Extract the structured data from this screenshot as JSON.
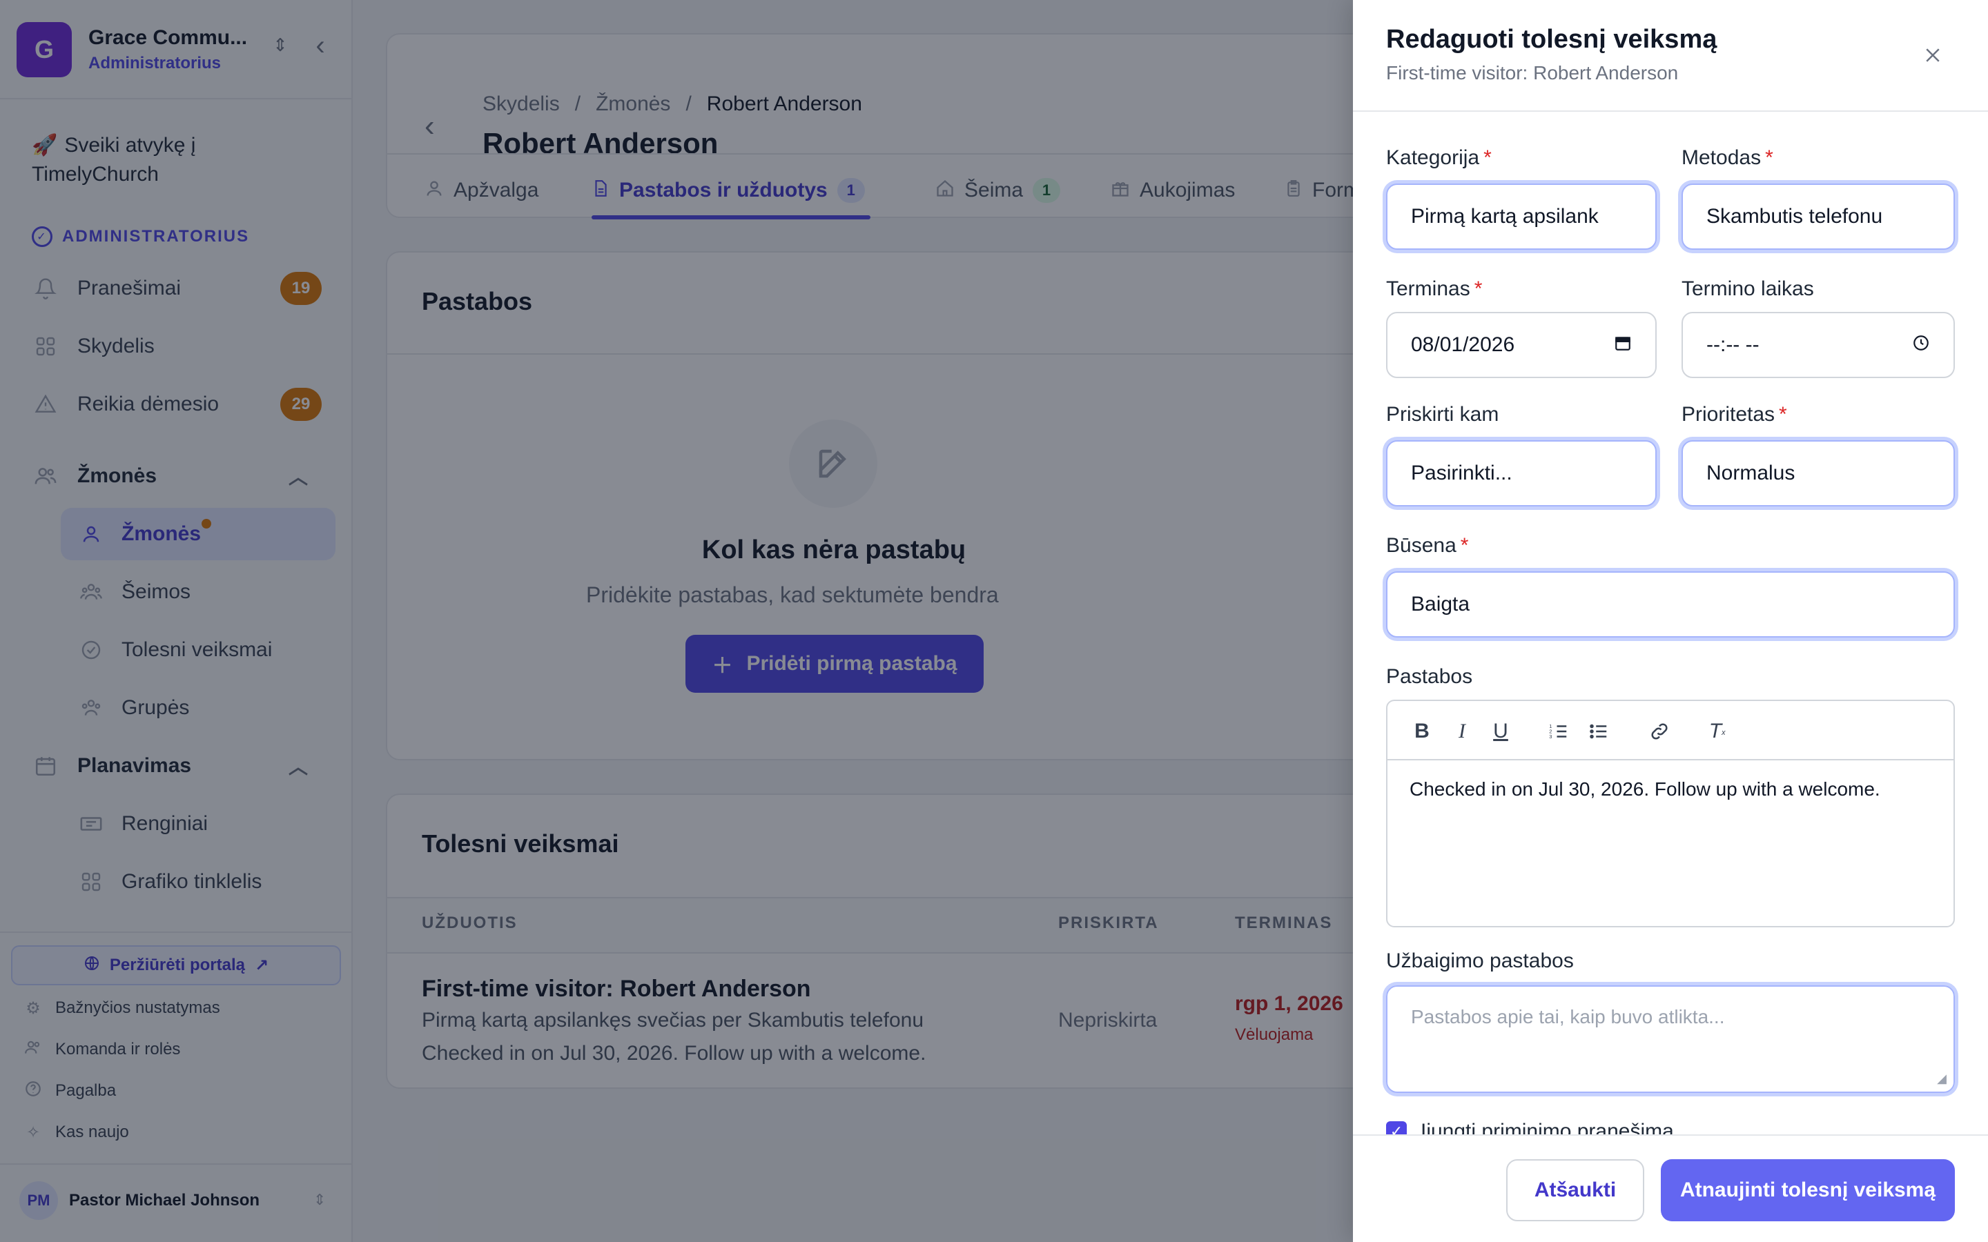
{
  "sidebar": {
    "org": {
      "initial": "G",
      "name": "Grace Commu...",
      "role": "Administratorius"
    },
    "welcome": "Sveiki atvykę į TimelyChurch",
    "section_label": "ADMINISTRATORIUS",
    "items": [
      {
        "label": "Pranešimai",
        "icon": "bell-icon",
        "badge": "19"
      },
      {
        "label": "Skydelis",
        "icon": "grid-icon"
      },
      {
        "label": "Reikia dėmesio",
        "icon": "warning-icon",
        "badge": "29"
      }
    ],
    "group_people": {
      "label": "Žmonės",
      "icon": "users-icon"
    },
    "people_items": [
      {
        "label": "Žmonės",
        "icon": "user-icon",
        "active": true
      },
      {
        "label": "Šeimos",
        "icon": "family-icon"
      },
      {
        "label": "Tolesni veiksmai",
        "icon": "check-circle-icon"
      },
      {
        "label": "Grupės",
        "icon": "group-icon"
      }
    ],
    "group_planning": {
      "label": "Planavimas",
      "icon": "calendar-icon"
    },
    "planning_items": [
      {
        "label": "Renginiai",
        "icon": "ticket-icon"
      },
      {
        "label": "Grafiko tinklelis",
        "icon": "grid-icon"
      }
    ],
    "portal_button": "Peržiūrėti portalą",
    "footer_links": [
      {
        "label": "Bažnyčios nustatymas",
        "icon": "gear-icon"
      },
      {
        "label": "Komanda ir rolės",
        "icon": "users-icon"
      },
      {
        "label": "Pagalba",
        "icon": "help-icon"
      },
      {
        "label": "Kas naujo",
        "icon": "sparkle-icon"
      }
    ],
    "user": {
      "initials": "PM",
      "name": "Pastor Michael Johnson"
    }
  },
  "main": {
    "breadcrumbs": [
      "Skydelis",
      "Žmonės",
      "Robert Anderson"
    ],
    "title": "Robert Anderson",
    "tabs": [
      {
        "label": "Apžvalga",
        "icon": "user-icon"
      },
      {
        "label": "Pastabos ir užduotys",
        "icon": "document-icon",
        "badge": "1",
        "active": true
      },
      {
        "label": "Šeima",
        "icon": "home-icon",
        "badge": "1"
      },
      {
        "label": "Aukojimas",
        "icon": "gift-icon"
      },
      {
        "label": "Formos",
        "icon": "clipboard-icon"
      }
    ],
    "notes": {
      "title": "Pastabos",
      "empty_title": "Kol kas nėra pastabų",
      "empty_desc": "Pridėkite pastabas, kad sektumėte bendra",
      "add_button": "Pridėti pirmą pastabą"
    },
    "followups": {
      "title": "Tolesni veiksmai",
      "columns": [
        "UŽDUOTIS",
        "PRISKIRTA",
        "TERMINAS"
      ],
      "rows": [
        {
          "title": "First-time visitor: Robert Anderson",
          "desc1": "Pirmą kartą apsilankęs svečias per Skambutis telefonu",
          "desc2": "Checked in on Jul 30, 2026. Follow up with a welcome.",
          "assigned": "Nepriskirta",
          "due": "rgp 1, 2026",
          "status": "Vėluojama"
        }
      ]
    }
  },
  "drawer": {
    "title": "Redaguoti tolesnį veiksmą",
    "subtitle": "First-time visitor: Robert Anderson",
    "fields": {
      "category": {
        "label": "Kategorija",
        "value": "Pirmą kartą apsilank"
      },
      "method": {
        "label": "Metodas",
        "value": "Skambutis telefonu"
      },
      "due": {
        "label": "Terminas",
        "value": "08/01/2026"
      },
      "due_time": {
        "label": "Termino laikas",
        "value": "--:-- --"
      },
      "assign": {
        "label": "Priskirti kam",
        "value": "Pasirinkti..."
      },
      "priority": {
        "label": "Prioritetas",
        "value": "Normalus"
      },
      "status": {
        "label": "Būsena",
        "value": "Baigta"
      },
      "notes": {
        "label": "Pastabos",
        "value": "Checked in on Jul 30, 2026. Follow up with a welcome."
      },
      "completion": {
        "label": "Užbaigimo pastabos",
        "placeholder": "Pastabos apie tai, kaip buvo atlikta..."
      }
    },
    "reminder_label": "Įjungti priminimo pranešimą",
    "cancel": "Atšaukti",
    "submit": "Atnaujinti tolesnį veiksmą"
  },
  "colors": {
    "accent": "#4f46e5",
    "badge": "#d97706",
    "overdue": "#b91c1c"
  }
}
